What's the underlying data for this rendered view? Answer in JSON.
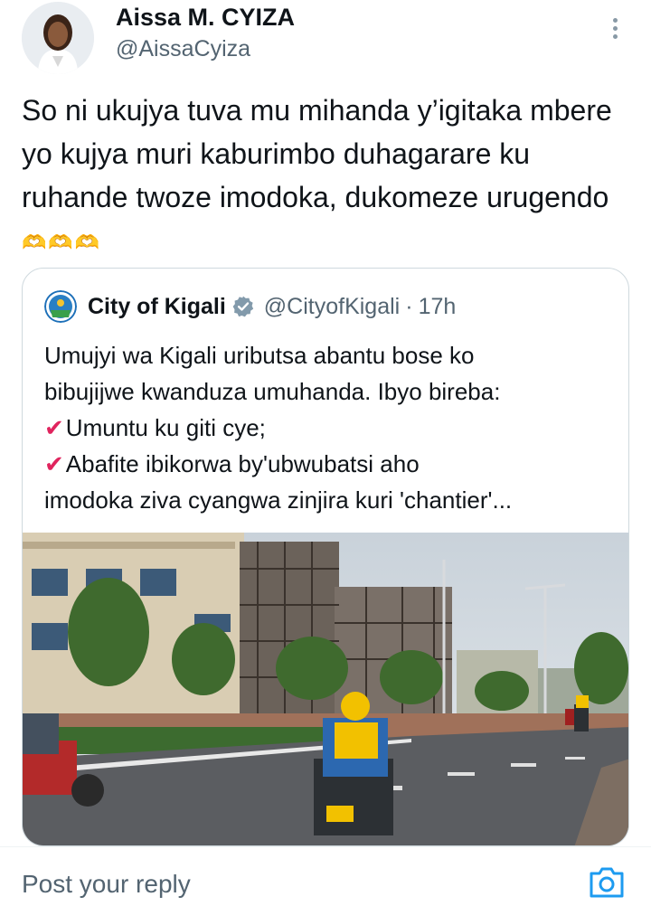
{
  "author": {
    "name": "Aissa M. CYIZA",
    "handle": "@AissaCyiza"
  },
  "tweet": {
    "text": "So ni ukujya tuva mu mihanda y’igitaka mbere yo kujya muri kaburimbo duhagarare ku ruhande twoze imodoka, dukomeze urugendo",
    "emoji": "🫶🫶🫶"
  },
  "quoted": {
    "name": "City of Kigali",
    "handle": "@CityofKigali",
    "separator": "·",
    "time": "17h",
    "lines": [
      "Umujyi wa Kigali  uributsa abantu bose ko",
      "bibujijwe kwanduza umuhanda. Ibyo bireba:",
      "Umuntu ku giti cye;",
      "Abafite ibikorwa by'ubwubatsi aho",
      "imodoka ziva cyangwa zinjira kuri 'chantier'..."
    ],
    "check_mark": "✔",
    "image_scene": "Street scene in Kigali with buildings under construction and a motorcycle rider in a yellow vest"
  },
  "reply": {
    "placeholder": "Post your reply"
  },
  "icons": {
    "more": "more-vertical-icon",
    "verified": "verified-badge-icon",
    "camera": "camera-icon",
    "check": "red-check-icon"
  },
  "colors": {
    "text_primary": "#0f1419",
    "text_secondary": "#536471",
    "accent": "#1d9bf0",
    "check_red": "#e0245e",
    "border": "#cfd9de"
  }
}
